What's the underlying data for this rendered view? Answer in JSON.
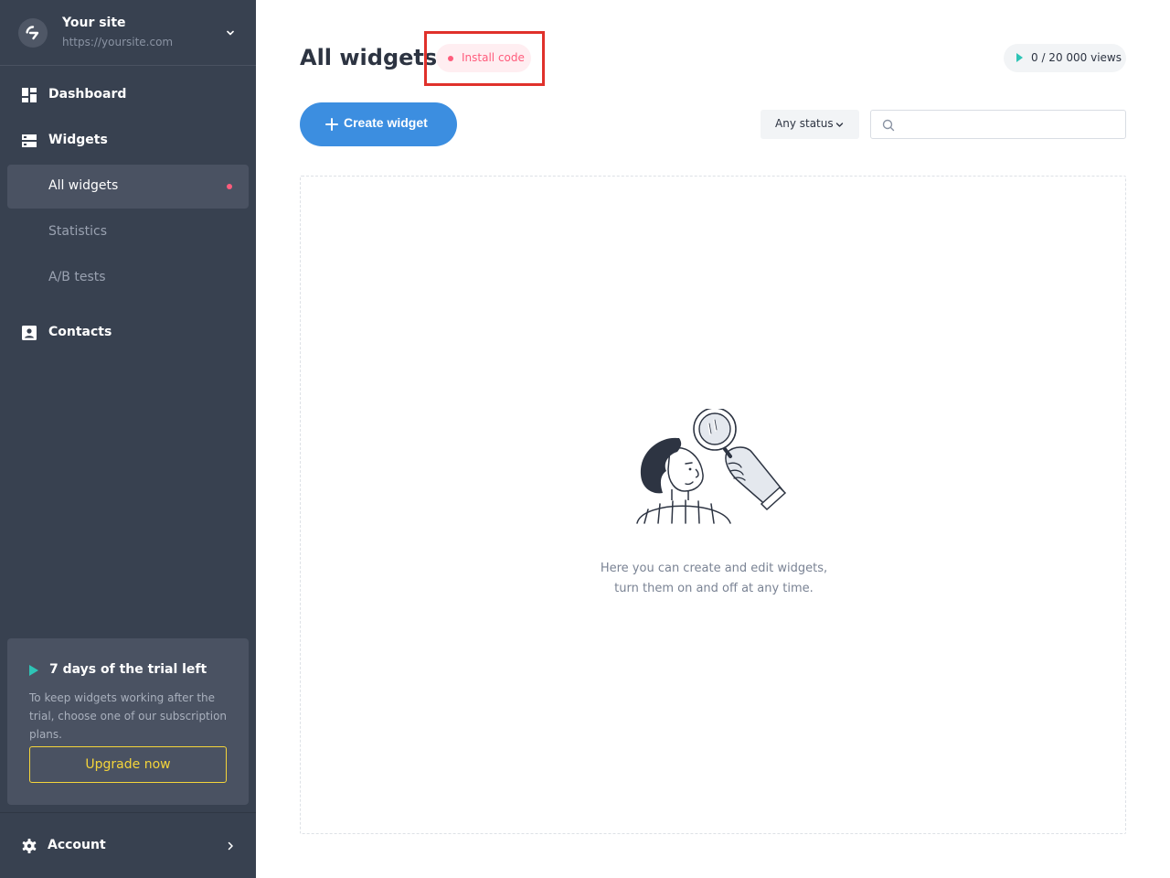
{
  "sidebar": {
    "site": {
      "name": "Your site",
      "url": "https://yoursite.com"
    },
    "nav": {
      "dashboard": "Dashboard",
      "widgets": "Widgets",
      "all_widgets": "All widgets",
      "statistics": "Statistics",
      "ab_tests": "A/B tests",
      "contacts": "Contacts"
    },
    "trial": {
      "title": "7 days of the trial left",
      "text": "To keep widgets working after the trial, choose one of our subscription plans.",
      "button": "Upgrade now"
    },
    "account": "Account"
  },
  "main": {
    "title": "All widgets",
    "install_badge": "Install code",
    "views_badge": "0 / 20 000 views",
    "create_button": "Create widget",
    "status_filter": "Any status",
    "search": {
      "value": "",
      "placeholder": ""
    },
    "empty_state": {
      "line1": "Here you can create and edit widgets,",
      "line2": "turn them on and off at any time."
    }
  },
  "colors": {
    "sidebar_bg": "#384150",
    "accent_blue": "#3c8ee0",
    "alert_pink": "#ff5c7c",
    "upgrade_yellow": "#f5d53a",
    "teal": "#2ec4b6",
    "highlight_red": "#e0312b"
  }
}
